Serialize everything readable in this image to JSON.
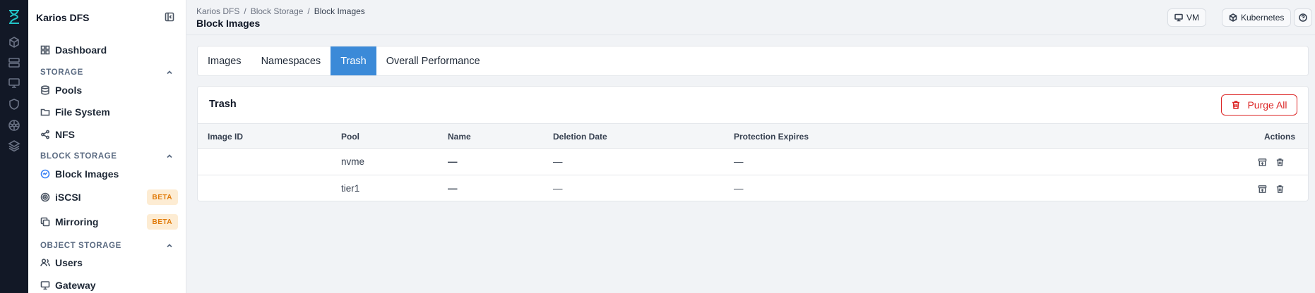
{
  "app": {
    "name": "Karios DFS"
  },
  "rail_icons": [
    "hourglass-logo-icon",
    "cube-icon",
    "server-icon",
    "monitor-icon",
    "shield-icon",
    "kubernetes-icon",
    "layers-icon"
  ],
  "sidebar": {
    "dashboard": "Dashboard",
    "storage_section": "STORAGE",
    "storage_items": [
      "Pools",
      "File System",
      "NFS"
    ],
    "block_section": "BLOCK STORAGE",
    "block_items": [
      "Block Images",
      "iSCSI",
      "Mirroring"
    ],
    "beta_label": "BETA",
    "object_section": "OBJECT STORAGE",
    "object_items": [
      "Users",
      "Gateway"
    ]
  },
  "header": {
    "breadcrumb": [
      "Karios DFS",
      "Block Storage",
      "Block Images"
    ],
    "separator": "/",
    "title": "Block Images",
    "vm_label": "VM",
    "kubernetes_label": "Kubernetes"
  },
  "tabs": [
    "Images",
    "Namespaces",
    "Trash",
    "Overall Performance"
  ],
  "active_tab": "Trash",
  "trash": {
    "title": "Trash",
    "purge_label": "Purge All",
    "columns": [
      "Image ID",
      "Pool",
      "Name",
      "Deletion Date",
      "Protection Expires",
      "Actions"
    ],
    "rows": [
      {
        "image_id": "",
        "pool": "nvme",
        "name": "—",
        "deletion_date": "—",
        "protection_expires": "—"
      },
      {
        "image_id": "",
        "pool": "tier1",
        "name": "—",
        "deletion_date": "—",
        "protection_expires": "—"
      }
    ]
  },
  "colors": {
    "accent": "#3b8ad8",
    "danger": "#dc2626",
    "rail": "#121826",
    "beta_bg": "#fdecd3",
    "beta_text": "#e07b0b"
  }
}
